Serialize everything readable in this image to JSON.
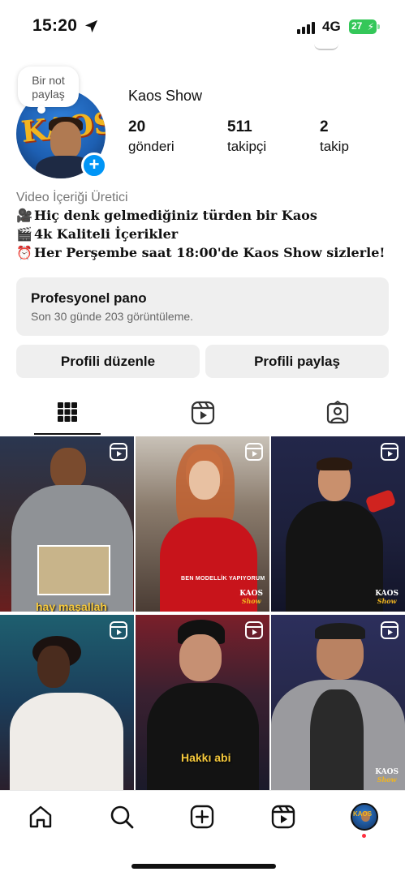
{
  "status_bar": {
    "time": "15:20",
    "network": "4G",
    "battery": "27"
  },
  "note": {
    "text": "Bir not paylaş"
  },
  "profile": {
    "username": "Kaos Show",
    "stats": [
      {
        "value": "20",
        "label": "gönderi"
      },
      {
        "value": "511",
        "label": "takipçi"
      },
      {
        "value": "2",
        "label": "takip"
      }
    ],
    "category": "Video İçeriği Üretici",
    "bio_lines": [
      {
        "emoji": "🎥",
        "text": "Hiç denk gelmediğiniz türden bir Kaos"
      },
      {
        "emoji": "🎬",
        "text": "4k Kaliteli İçerikler"
      },
      {
        "emoji": "⏰",
        "text": "Her Perşembe saat 18:00'de Kaos Show sizlerle!"
      }
    ]
  },
  "dashboard": {
    "title": "Profesyonel pano",
    "subtitle": "Son 30 günde 203 görüntüleme."
  },
  "actions": {
    "edit_profile": "Profili düzenle",
    "share_profile": "Profili paylaş"
  },
  "tabs": [
    {
      "name": "grid",
      "icon": "grid-icon",
      "active": true
    },
    {
      "name": "reels",
      "icon": "reels-icon",
      "active": false
    },
    {
      "name": "tagged",
      "icon": "tagged-icon",
      "active": false
    }
  ],
  "posts": [
    {
      "caption": "hay maşallah",
      "type": "reel"
    },
    {
      "caption": "BEN MODELLİK YAPIYORUM",
      "watermark": "KAOS",
      "watermark_sub": "Show",
      "type": "reel"
    },
    {
      "watermark": "KAOS",
      "watermark_sub": "Show",
      "type": "reel"
    },
    {
      "type": "reel"
    },
    {
      "caption": "Hakkı abi",
      "type": "reel"
    },
    {
      "watermark": "KAOS",
      "watermark_sub": "Show",
      "type": "reel"
    }
  ],
  "bottom_nav": [
    {
      "name": "home",
      "icon": "home-icon"
    },
    {
      "name": "search",
      "icon": "search-icon"
    },
    {
      "name": "create",
      "icon": "plus-square-icon"
    },
    {
      "name": "reels",
      "icon": "reels-icon"
    },
    {
      "name": "profile",
      "icon": "profile-avatar"
    }
  ],
  "colors": {
    "accent": "#0095f6",
    "button_bg": "#efefef",
    "notification": "#ff3040",
    "battery": "#34c759"
  }
}
